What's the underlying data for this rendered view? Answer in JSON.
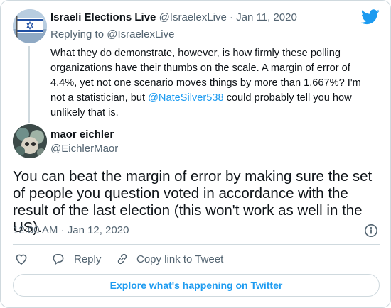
{
  "parent_tweet": {
    "author_name": "Israeli Elections Live",
    "author_handle": "@IsraelexLive",
    "separator": "·",
    "date": "Jan 11, 2020",
    "replying_to_label": "Replying to ",
    "replying_to_handle": "@IsraelexLive",
    "text_before_mention": "What they do demonstrate, however, is how firmly these polling organizations have their thumbs on the scale. A margin of error of 4.4%, yet not one scenario moves things by more than 1.667%? I'm not a statistician, but ",
    "mention": "@NateSilver538",
    "text_after_mention": " could probably tell you how unlikely that is."
  },
  "main_tweet": {
    "author_name": "maor eichler",
    "author_handle": "@EichlerMaor",
    "text": "You can beat the margin of error by making sure the set of people you question voted in accordance with the result of the last election (this won't work as well in the US).",
    "time": "12:00 AM",
    "separator": "·",
    "date": "Jan 12, 2020"
  },
  "actions": {
    "reply_label": "Reply",
    "copy_link_label": "Copy link to Tweet",
    "explore_label": "Explore what's happening on Twitter"
  },
  "icons": {
    "brand": "twitter-bird-icon",
    "like": "heart-icon",
    "reply": "reply-bubble-icon",
    "copy": "link-icon",
    "info": "info-icon"
  },
  "colors": {
    "accent": "#1d9bf0",
    "text": "#0f1419",
    "muted": "#536471",
    "border": "#cfd9de"
  }
}
